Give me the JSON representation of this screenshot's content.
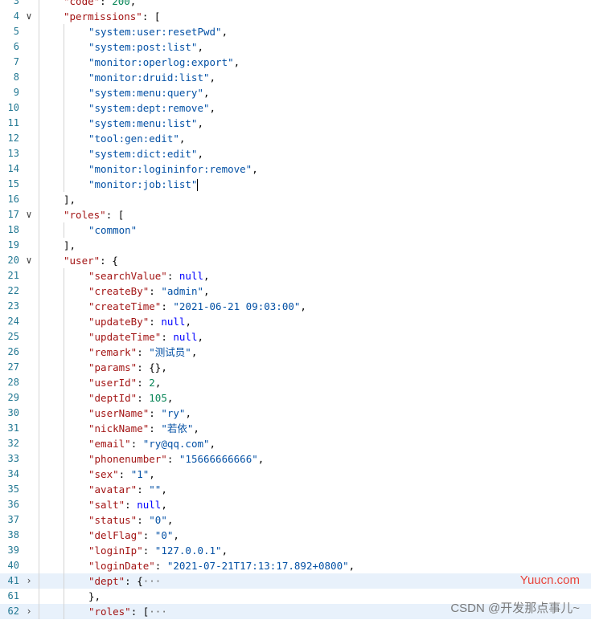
{
  "lines": [
    {
      "n": "3",
      "fold": "",
      "ind": 1,
      "hl": false,
      "parts": [
        [
          "k",
          "\"code\""
        ],
        [
          "p",
          ": "
        ],
        [
          "n",
          "200"
        ],
        [
          "p",
          ","
        ]
      ]
    },
    {
      "n": "4",
      "fold": "v",
      "ind": 1,
      "hl": false,
      "parts": [
        [
          "k",
          "\"permissions\""
        ],
        [
          "p",
          ": ["
        ]
      ]
    },
    {
      "n": "5",
      "fold": "",
      "ind": 2,
      "hl": false,
      "parts": [
        [
          "s",
          "\"system:user:resetPwd\""
        ],
        [
          "p",
          ","
        ]
      ]
    },
    {
      "n": "6",
      "fold": "",
      "ind": 2,
      "hl": false,
      "parts": [
        [
          "s",
          "\"system:post:list\""
        ],
        [
          "p",
          ","
        ]
      ]
    },
    {
      "n": "7",
      "fold": "",
      "ind": 2,
      "hl": false,
      "parts": [
        [
          "s",
          "\"monitor:operlog:export\""
        ],
        [
          "p",
          ","
        ]
      ]
    },
    {
      "n": "8",
      "fold": "",
      "ind": 2,
      "hl": false,
      "parts": [
        [
          "s",
          "\"monitor:druid:list\""
        ],
        [
          "p",
          ","
        ]
      ]
    },
    {
      "n": "9",
      "fold": "",
      "ind": 2,
      "hl": false,
      "parts": [
        [
          "s",
          "\"system:menu:query\""
        ],
        [
          "p",
          ","
        ]
      ]
    },
    {
      "n": "10",
      "fold": "",
      "ind": 2,
      "hl": false,
      "parts": [
        [
          "s",
          "\"system:dept:remove\""
        ],
        [
          "p",
          ","
        ]
      ]
    },
    {
      "n": "11",
      "fold": "",
      "ind": 2,
      "hl": false,
      "parts": [
        [
          "s",
          "\"system:menu:list\""
        ],
        [
          "p",
          ","
        ]
      ]
    },
    {
      "n": "12",
      "fold": "",
      "ind": 2,
      "hl": false,
      "parts": [
        [
          "s",
          "\"tool:gen:edit\""
        ],
        [
          "p",
          ","
        ]
      ]
    },
    {
      "n": "13",
      "fold": "",
      "ind": 2,
      "hl": false,
      "parts": [
        [
          "s",
          "\"system:dict:edit\""
        ],
        [
          "p",
          ","
        ]
      ]
    },
    {
      "n": "14",
      "fold": "",
      "ind": 2,
      "hl": false,
      "parts": [
        [
          "s",
          "\"monitor:logininfor:remove\""
        ],
        [
          "p",
          ","
        ]
      ]
    },
    {
      "n": "15",
      "fold": "",
      "ind": 2,
      "hl": false,
      "cursor": true,
      "parts": [
        [
          "s",
          "\"monitor:job:list\""
        ]
      ]
    },
    {
      "n": "16",
      "fold": "",
      "ind": 1,
      "hl": false,
      "parts": [
        [
          "p",
          "],"
        ]
      ]
    },
    {
      "n": "17",
      "fold": "v",
      "ind": 1,
      "hl": false,
      "parts": [
        [
          "k",
          "\"roles\""
        ],
        [
          "p",
          ": ["
        ]
      ]
    },
    {
      "n": "18",
      "fold": "",
      "ind": 2,
      "hl": false,
      "parts": [
        [
          "s",
          "\"common\""
        ]
      ]
    },
    {
      "n": "19",
      "fold": "",
      "ind": 1,
      "hl": false,
      "parts": [
        [
          "p",
          "],"
        ]
      ]
    },
    {
      "n": "20",
      "fold": "v",
      "ind": 1,
      "hl": false,
      "parts": [
        [
          "k",
          "\"user\""
        ],
        [
          "p",
          ": {"
        ]
      ]
    },
    {
      "n": "21",
      "fold": "",
      "ind": 2,
      "hl": false,
      "parts": [
        [
          "k",
          "\"searchValue\""
        ],
        [
          "p",
          ": "
        ],
        [
          "kw",
          "null"
        ],
        [
          "p",
          ","
        ]
      ]
    },
    {
      "n": "22",
      "fold": "",
      "ind": 2,
      "hl": false,
      "parts": [
        [
          "k",
          "\"createBy\""
        ],
        [
          "p",
          ": "
        ],
        [
          "s",
          "\"admin\""
        ],
        [
          "p",
          ","
        ]
      ]
    },
    {
      "n": "23",
      "fold": "",
      "ind": 2,
      "hl": false,
      "parts": [
        [
          "k",
          "\"createTime\""
        ],
        [
          "p",
          ": "
        ],
        [
          "s",
          "\"2021-06-21 09:03:00\""
        ],
        [
          "p",
          ","
        ]
      ]
    },
    {
      "n": "24",
      "fold": "",
      "ind": 2,
      "hl": false,
      "parts": [
        [
          "k",
          "\"updateBy\""
        ],
        [
          "p",
          ": "
        ],
        [
          "kw",
          "null"
        ],
        [
          "p",
          ","
        ]
      ]
    },
    {
      "n": "25",
      "fold": "",
      "ind": 2,
      "hl": false,
      "parts": [
        [
          "k",
          "\"updateTime\""
        ],
        [
          "p",
          ": "
        ],
        [
          "kw",
          "null"
        ],
        [
          "p",
          ","
        ]
      ]
    },
    {
      "n": "26",
      "fold": "",
      "ind": 2,
      "hl": false,
      "parts": [
        [
          "k",
          "\"remark\""
        ],
        [
          "p",
          ": "
        ],
        [
          "s",
          "\"测试员\""
        ],
        [
          "p",
          ","
        ]
      ]
    },
    {
      "n": "27",
      "fold": "",
      "ind": 2,
      "hl": false,
      "parts": [
        [
          "k",
          "\"params\""
        ],
        [
          "p",
          ": {},"
        ]
      ]
    },
    {
      "n": "28",
      "fold": "",
      "ind": 2,
      "hl": false,
      "parts": [
        [
          "k",
          "\"userId\""
        ],
        [
          "p",
          ": "
        ],
        [
          "n",
          "2"
        ],
        [
          "p",
          ","
        ]
      ]
    },
    {
      "n": "29",
      "fold": "",
      "ind": 2,
      "hl": false,
      "parts": [
        [
          "k",
          "\"deptId\""
        ],
        [
          "p",
          ": "
        ],
        [
          "n",
          "105"
        ],
        [
          "p",
          ","
        ]
      ]
    },
    {
      "n": "30",
      "fold": "",
      "ind": 2,
      "hl": false,
      "parts": [
        [
          "k",
          "\"userName\""
        ],
        [
          "p",
          ": "
        ],
        [
          "s",
          "\"ry\""
        ],
        [
          "p",
          ","
        ]
      ]
    },
    {
      "n": "31",
      "fold": "",
      "ind": 2,
      "hl": false,
      "parts": [
        [
          "k",
          "\"nickName\""
        ],
        [
          "p",
          ": "
        ],
        [
          "s",
          "\"若依\""
        ],
        [
          "p",
          ","
        ]
      ]
    },
    {
      "n": "32",
      "fold": "",
      "ind": 2,
      "hl": false,
      "parts": [
        [
          "k",
          "\"email\""
        ],
        [
          "p",
          ": "
        ],
        [
          "s",
          "\"ry@qq.com\""
        ],
        [
          "p",
          ","
        ]
      ]
    },
    {
      "n": "33",
      "fold": "",
      "ind": 2,
      "hl": false,
      "parts": [
        [
          "k",
          "\"phonenumber\""
        ],
        [
          "p",
          ": "
        ],
        [
          "s",
          "\"15666666666\""
        ],
        [
          "p",
          ","
        ]
      ]
    },
    {
      "n": "34",
      "fold": "",
      "ind": 2,
      "hl": false,
      "parts": [
        [
          "k",
          "\"sex\""
        ],
        [
          "p",
          ": "
        ],
        [
          "s",
          "\"1\""
        ],
        [
          "p",
          ","
        ]
      ]
    },
    {
      "n": "35",
      "fold": "",
      "ind": 2,
      "hl": false,
      "parts": [
        [
          "k",
          "\"avatar\""
        ],
        [
          "p",
          ": "
        ],
        [
          "s",
          "\"\""
        ],
        [
          "p",
          ","
        ]
      ]
    },
    {
      "n": "36",
      "fold": "",
      "ind": 2,
      "hl": false,
      "parts": [
        [
          "k",
          "\"salt\""
        ],
        [
          "p",
          ": "
        ],
        [
          "kw",
          "null"
        ],
        [
          "p",
          ","
        ]
      ]
    },
    {
      "n": "37",
      "fold": "",
      "ind": 2,
      "hl": false,
      "parts": [
        [
          "k",
          "\"status\""
        ],
        [
          "p",
          ": "
        ],
        [
          "s",
          "\"0\""
        ],
        [
          "p",
          ","
        ]
      ]
    },
    {
      "n": "38",
      "fold": "",
      "ind": 2,
      "hl": false,
      "parts": [
        [
          "k",
          "\"delFlag\""
        ],
        [
          "p",
          ": "
        ],
        [
          "s",
          "\"0\""
        ],
        [
          "p",
          ","
        ]
      ]
    },
    {
      "n": "39",
      "fold": "",
      "ind": 2,
      "hl": false,
      "parts": [
        [
          "k",
          "\"loginIp\""
        ],
        [
          "p",
          ": "
        ],
        [
          "s",
          "\"127.0.0.1\""
        ],
        [
          "p",
          ","
        ]
      ]
    },
    {
      "n": "40",
      "fold": "",
      "ind": 2,
      "hl": false,
      "parts": [
        [
          "k",
          "\"loginDate\""
        ],
        [
          "p",
          ": "
        ],
        [
          "s",
          "\"2021-07-21T17:13:17.892+0800\""
        ],
        [
          "p",
          ","
        ]
      ]
    },
    {
      "n": "41",
      "fold": ">",
      "ind": 2,
      "hl": true,
      "parts": [
        [
          "k",
          "\"dept\""
        ],
        [
          "p",
          ": {"
        ],
        [
          "ellip",
          "···"
        ]
      ]
    },
    {
      "n": "61",
      "fold": "",
      "ind": 2,
      "hl": false,
      "parts": [
        [
          "p",
          "},"
        ]
      ]
    },
    {
      "n": "62",
      "fold": ">",
      "ind": 2,
      "hl": true,
      "parts": [
        [
          "k",
          "\"roles\""
        ],
        [
          "p",
          ": ["
        ],
        [
          "ellip",
          "···"
        ]
      ]
    }
  ],
  "watermark": {
    "site": "Yuucn.com",
    "author": "CSDN @开发那点事儿~"
  }
}
